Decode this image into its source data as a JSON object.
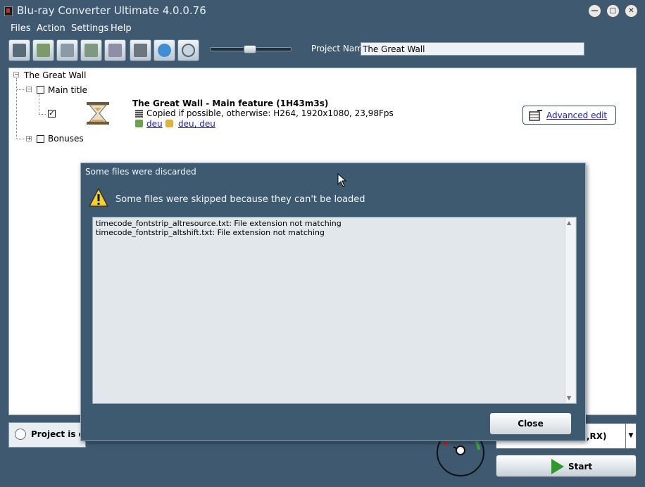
{
  "window": {
    "title": "Blu-ray Converter Ultimate 4.0.0.76"
  },
  "menu": [
    "Files",
    "Action",
    "Settings",
    "Help"
  ],
  "toolbar": {
    "buttons": [
      "add-video-icon",
      "add-audio-icon",
      "add-subtitle-icon",
      "add-chapter-icon",
      "remove-icon",
      "settings-icon",
      "burn-disc-icon",
      "preview-icon"
    ],
    "project_label": "Project Name",
    "project_name": "The Great Wall"
  },
  "tree": {
    "root": "The Great Wall",
    "main_title": "Main title",
    "feature_title": "The Great Wall - Main feature (1H43m3s)",
    "feature_info": "Copied if possible, otherwise: H264, 1920x1080, 23,98Fps",
    "audio_link": "deu",
    "subtitle_link": "deu, deu",
    "advanced_edit": "Advanced edit",
    "bonuses": "Bonuses"
  },
  "status": {
    "text": "Project is en"
  },
  "profile": {
    "selected_text": ",RX)"
  },
  "start": {
    "label": "Start"
  },
  "dialog": {
    "title": "Some files were discarded",
    "message": "Some files were skipped because they can't be loaded",
    "files": [
      "timecode_fontstrip_altresource.txt: File extension not matching",
      "timecode_fontstrip_altshift.txt: File extension not matching"
    ],
    "close_label": "Close"
  }
}
